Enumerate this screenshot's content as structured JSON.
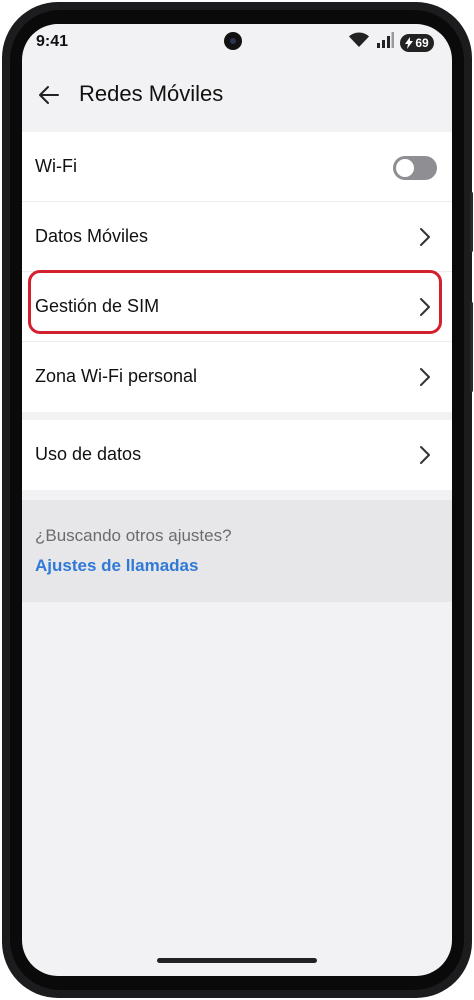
{
  "status_bar": {
    "time": "9:41",
    "battery": "69"
  },
  "header": {
    "title": "Redes Móviles"
  },
  "section1": {
    "wifi_label": "Wi-Fi",
    "wifi_enabled": false,
    "datos_label": "Datos Móviles",
    "sim_label": "Gestión de SIM",
    "hotspot_label": "Zona Wi-Fi personal"
  },
  "section2": {
    "uso_label": "Uso de datos"
  },
  "more_settings": {
    "question": "¿Buscando otros ajustes?",
    "link": "Ajustes de llamadas"
  },
  "colors": {
    "highlight": "#d3202d",
    "link": "#2f7ad6"
  }
}
